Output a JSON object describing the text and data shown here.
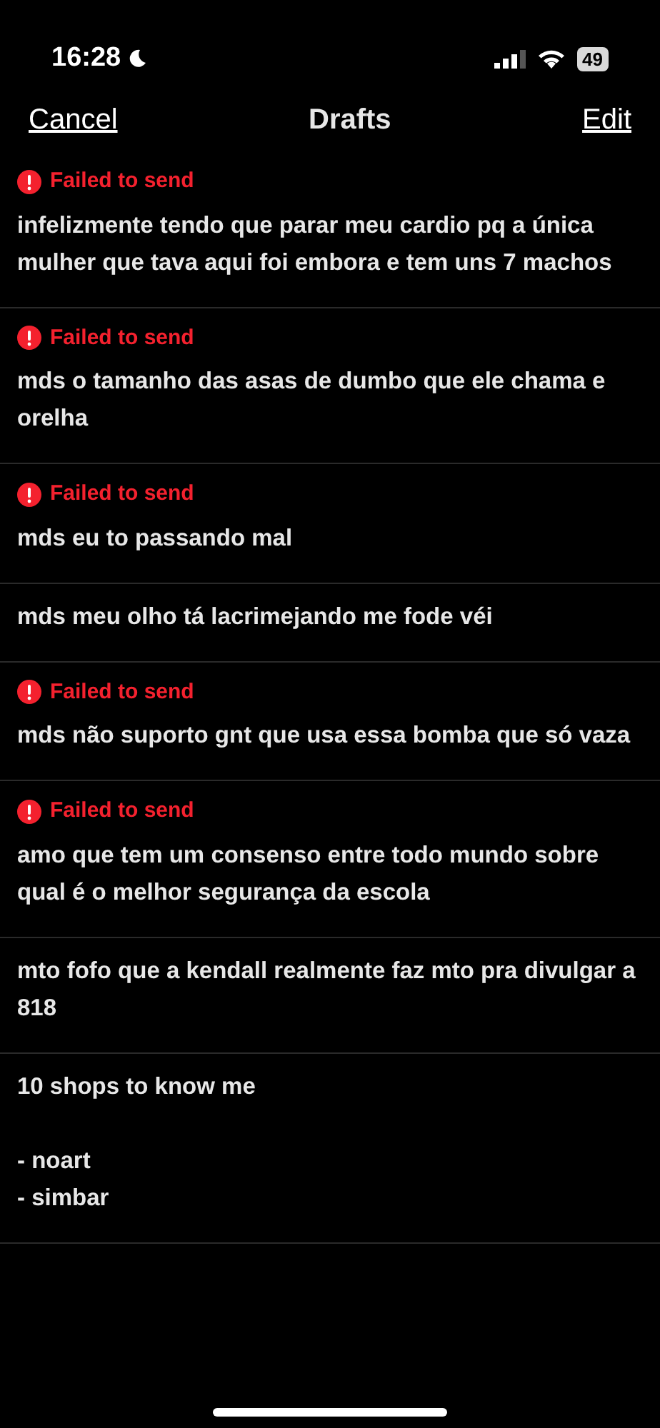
{
  "status_bar": {
    "time": "16:28",
    "battery": "49"
  },
  "nav": {
    "cancel": "Cancel",
    "title": "Drafts",
    "edit": "Edit"
  },
  "drafts": [
    {
      "failed": true,
      "error": "Failed to send",
      "text": "infelizmente tendo que parar meu cardio pq a única mulher que tava aqui foi embora e tem uns 7 machos"
    },
    {
      "failed": true,
      "error": "Failed to send",
      "text": "mds o tamanho das asas de dumbo que ele chama e orelha"
    },
    {
      "failed": true,
      "error": "Failed to send",
      "text": "mds eu to passando mal"
    },
    {
      "failed": false,
      "text": "mds meu olho tá lacrimejando me fode véi"
    },
    {
      "failed": true,
      "error": "Failed to send",
      "text": "mds não suporto gnt que usa essa bomba que só vaza"
    },
    {
      "failed": true,
      "error": "Failed to send",
      "text": "amo que tem um consenso entre todo mundo sobre qual é o melhor segurança da escola"
    },
    {
      "failed": false,
      "text": "mto fofo que a kendall realmente faz mto pra divulgar a 818"
    },
    {
      "failed": false,
      "text": "10 shops to know me\n\n- noart\n- simbar"
    }
  ]
}
